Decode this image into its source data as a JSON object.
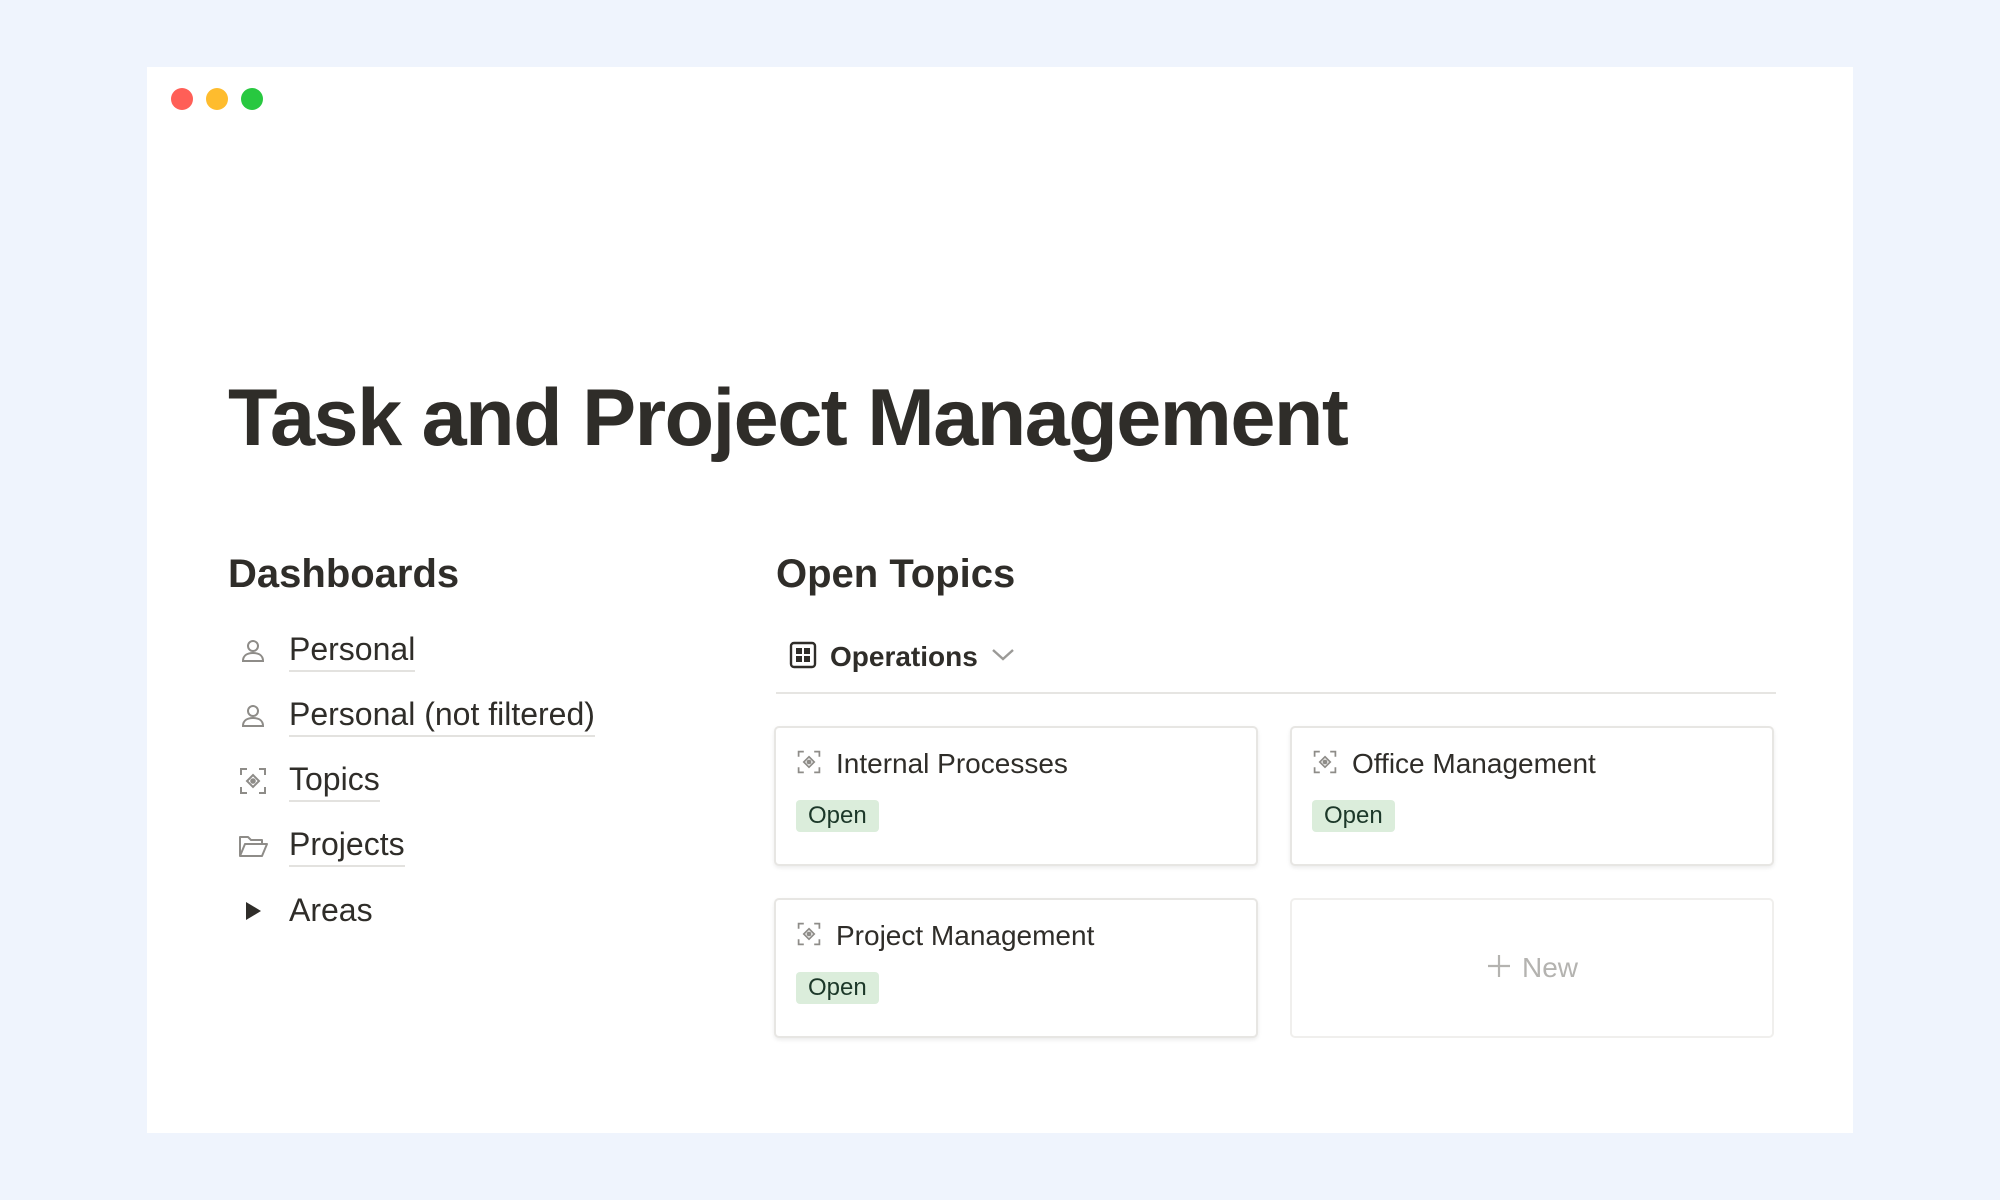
{
  "page": {
    "title": "Task and Project Management"
  },
  "dashboards": {
    "heading": "Dashboards",
    "items": [
      {
        "label": "Personal",
        "icon": "person-icon"
      },
      {
        "label": "Personal (not filtered)",
        "icon": "person-icon"
      },
      {
        "label": "Topics",
        "icon": "topic-icon"
      },
      {
        "label": "Projects",
        "icon": "folder-icon"
      },
      {
        "label": "Areas",
        "icon": "triangle-right-icon"
      }
    ]
  },
  "topics": {
    "heading": "Open Topics",
    "view": {
      "label": "Operations",
      "icon": "gallery-view-icon"
    },
    "cards": [
      {
        "title": "Internal Processes",
        "status": "Open"
      },
      {
        "title": "Office Management",
        "status": "Open"
      },
      {
        "title": "Project Management",
        "status": "Open"
      }
    ],
    "new_label": "New"
  },
  "colors": {
    "badge_bg": "#dbeddb",
    "badge_text": "#1c3829",
    "background": "#eff4fd"
  }
}
